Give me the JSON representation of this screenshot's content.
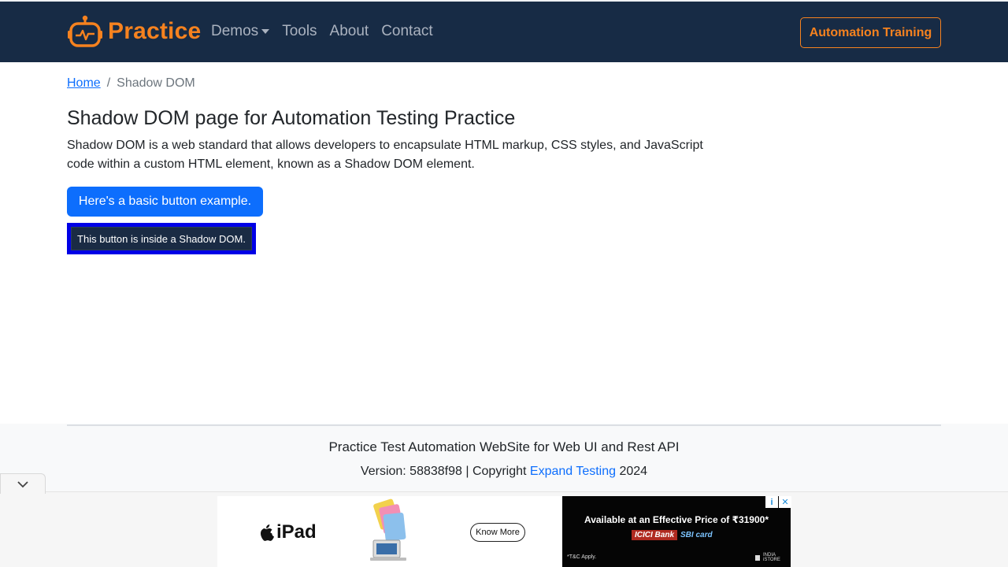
{
  "navbar": {
    "brand": "Practice",
    "links": [
      {
        "label": "Demos",
        "has_dropdown": true
      },
      {
        "label": "Tools"
      },
      {
        "label": "About"
      },
      {
        "label": "Contact"
      }
    ],
    "cta_label": "Automation Training",
    "colors": {
      "background": "#172b45",
      "accent": "#f6821f",
      "link": "#aab2bf"
    }
  },
  "breadcrumb": {
    "home": "Home",
    "separator": "/",
    "current": "Shadow DOM"
  },
  "main": {
    "title": "Shadow DOM page for Automation Testing Practice",
    "description": "Shadow DOM is a web standard that allows developers to encapsulate HTML markup, CSS styles, and JavaScript code within a custom HTML element, known as a Shadow DOM element.",
    "basic_button_label": "Here's a basic button example.",
    "shadow_button_label": "This button is inside a Shadow DOM."
  },
  "footer": {
    "title": "Practice Test Automation WebSite for Web UI and Rest API",
    "version_prefix": "Version: 58838f98 | Copyright ",
    "company_link": "Expand Testing",
    "year": " 2024"
  },
  "ad": {
    "product": "iPad",
    "know_more": "Know More",
    "offer_text": "Available at an Effective Price of ₹31900*",
    "bank_1": "ICICI Bank",
    "bank_2": "SBI card",
    "tnc": "*T&C Apply.",
    "store_line1": "INDIA",
    "store_line2": "iSTORE",
    "adchoice_info": "i",
    "adchoice_close": "✕"
  }
}
